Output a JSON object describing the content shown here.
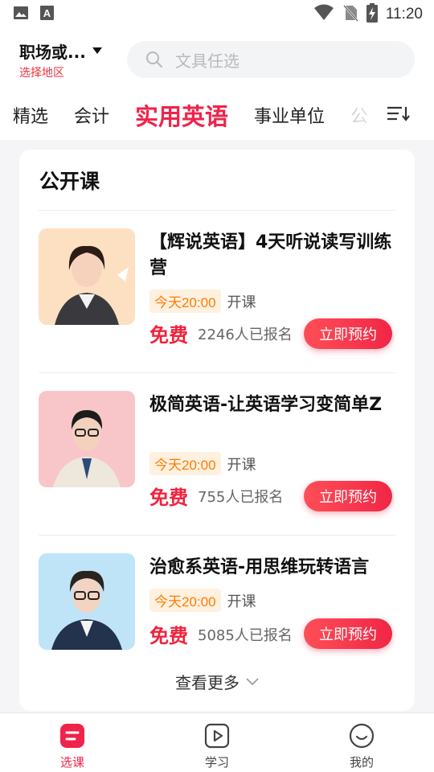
{
  "status_bar": {
    "time": "11:20"
  },
  "header": {
    "region_name": "职场或...",
    "region_hint": "选择地区",
    "search_placeholder": "文具任选"
  },
  "tabs": [
    {
      "label": "精选"
    },
    {
      "label": "会计"
    },
    {
      "label": "实用英语"
    },
    {
      "label": "事业单位"
    },
    {
      "label": "公"
    }
  ],
  "section": {
    "title": "公开课"
  },
  "courses": [
    {
      "title": "【辉说英语】4天听说读写训练营",
      "time": "今天20:00",
      "open_label": "开课",
      "price": "免费",
      "enrolled": "2246人已报名",
      "button": "立即预约"
    },
    {
      "title": "极简英语-让英语学习变简单Z",
      "time": "今天20:00",
      "open_label": "开课",
      "price": "免费",
      "enrolled": "755人已报名",
      "button": "立即预约"
    },
    {
      "title": "治愈系英语-用思维玩转语言",
      "time": "今天20:00",
      "open_label": "开课",
      "price": "免费",
      "enrolled": "5085人已报名",
      "button": "立即预约"
    }
  ],
  "more_label": "查看更多",
  "bottom_nav": [
    {
      "label": "选课",
      "icon": "course-select-icon"
    },
    {
      "label": "学习",
      "icon": "play-icon"
    },
    {
      "label": "我的",
      "icon": "smile-profile-icon"
    }
  ],
  "colors": {
    "accent": "#f0234a",
    "badge_text": "#ff7a00",
    "badge_bg": "#fff1e0",
    "page_bg": "#f5f5f7"
  }
}
